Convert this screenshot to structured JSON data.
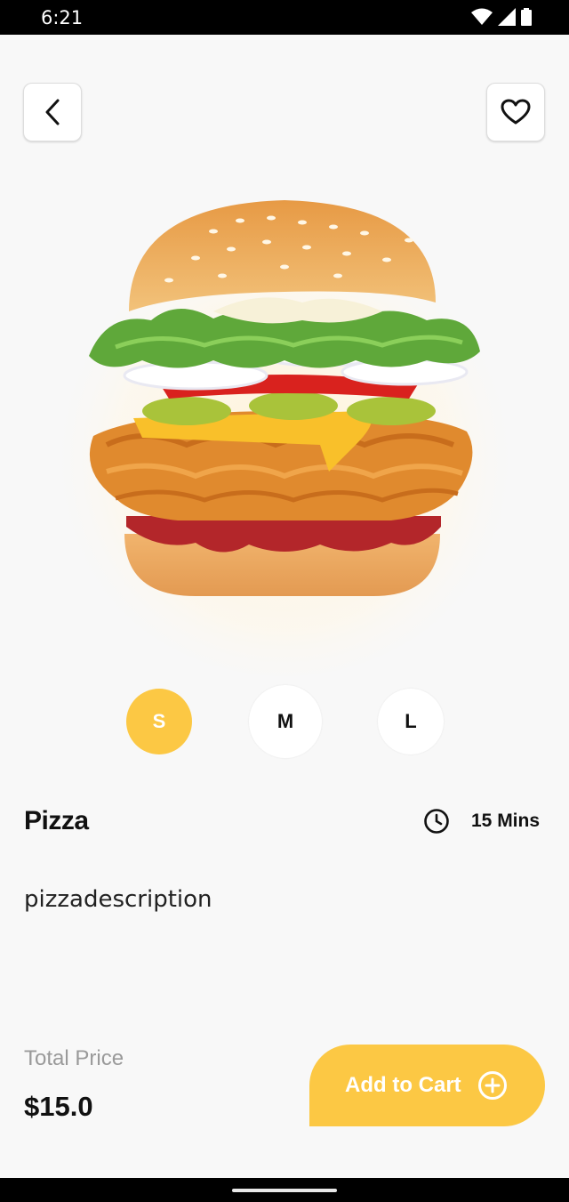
{
  "status_bar": {
    "time": "6:21"
  },
  "product": {
    "name": "Pizza",
    "description": "pizzadescription",
    "prep_time": "15 Mins",
    "image": "burger-image"
  },
  "sizes": [
    {
      "label": "S",
      "selected": true
    },
    {
      "label": "M",
      "selected": false
    },
    {
      "label": "L",
      "selected": false
    }
  ],
  "footer": {
    "total_label": "Total Price",
    "total_value": "$15.0",
    "add_to_cart_label": "Add to Cart"
  },
  "colors": {
    "accent": "#fcc844",
    "background": "#f8f8f8"
  },
  "icons": {
    "back": "chevron-left-icon",
    "favorite": "heart-icon",
    "time": "clock-icon",
    "add": "plus-circle-icon"
  }
}
